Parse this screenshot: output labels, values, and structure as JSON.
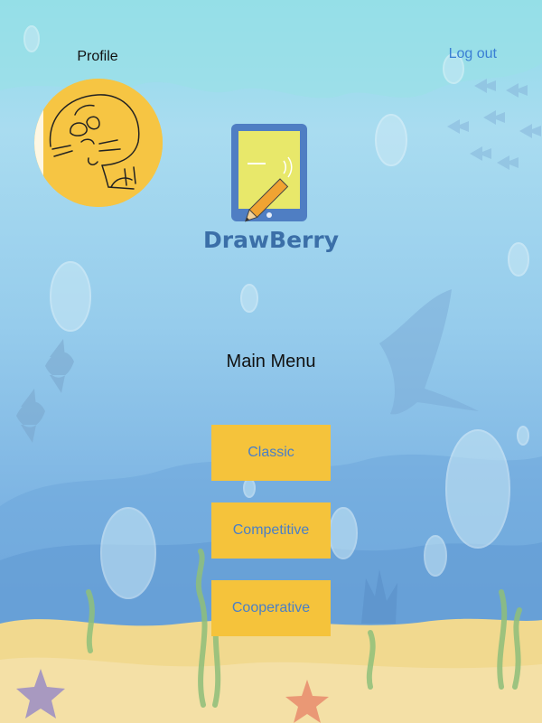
{
  "header": {
    "profile_label": "Profile",
    "logout_label": "Log out"
  },
  "logo": {
    "text": "DrawBerry"
  },
  "main": {
    "title": "Main Menu"
  },
  "menu": {
    "classic": "Classic",
    "competitive": "Competitive",
    "cooperative": "Cooperative"
  },
  "colors": {
    "button_bg": "#f5c33b",
    "button_text": "#4a7fc6",
    "link": "#3a7fd4",
    "logo_text": "#3b6fa8"
  }
}
